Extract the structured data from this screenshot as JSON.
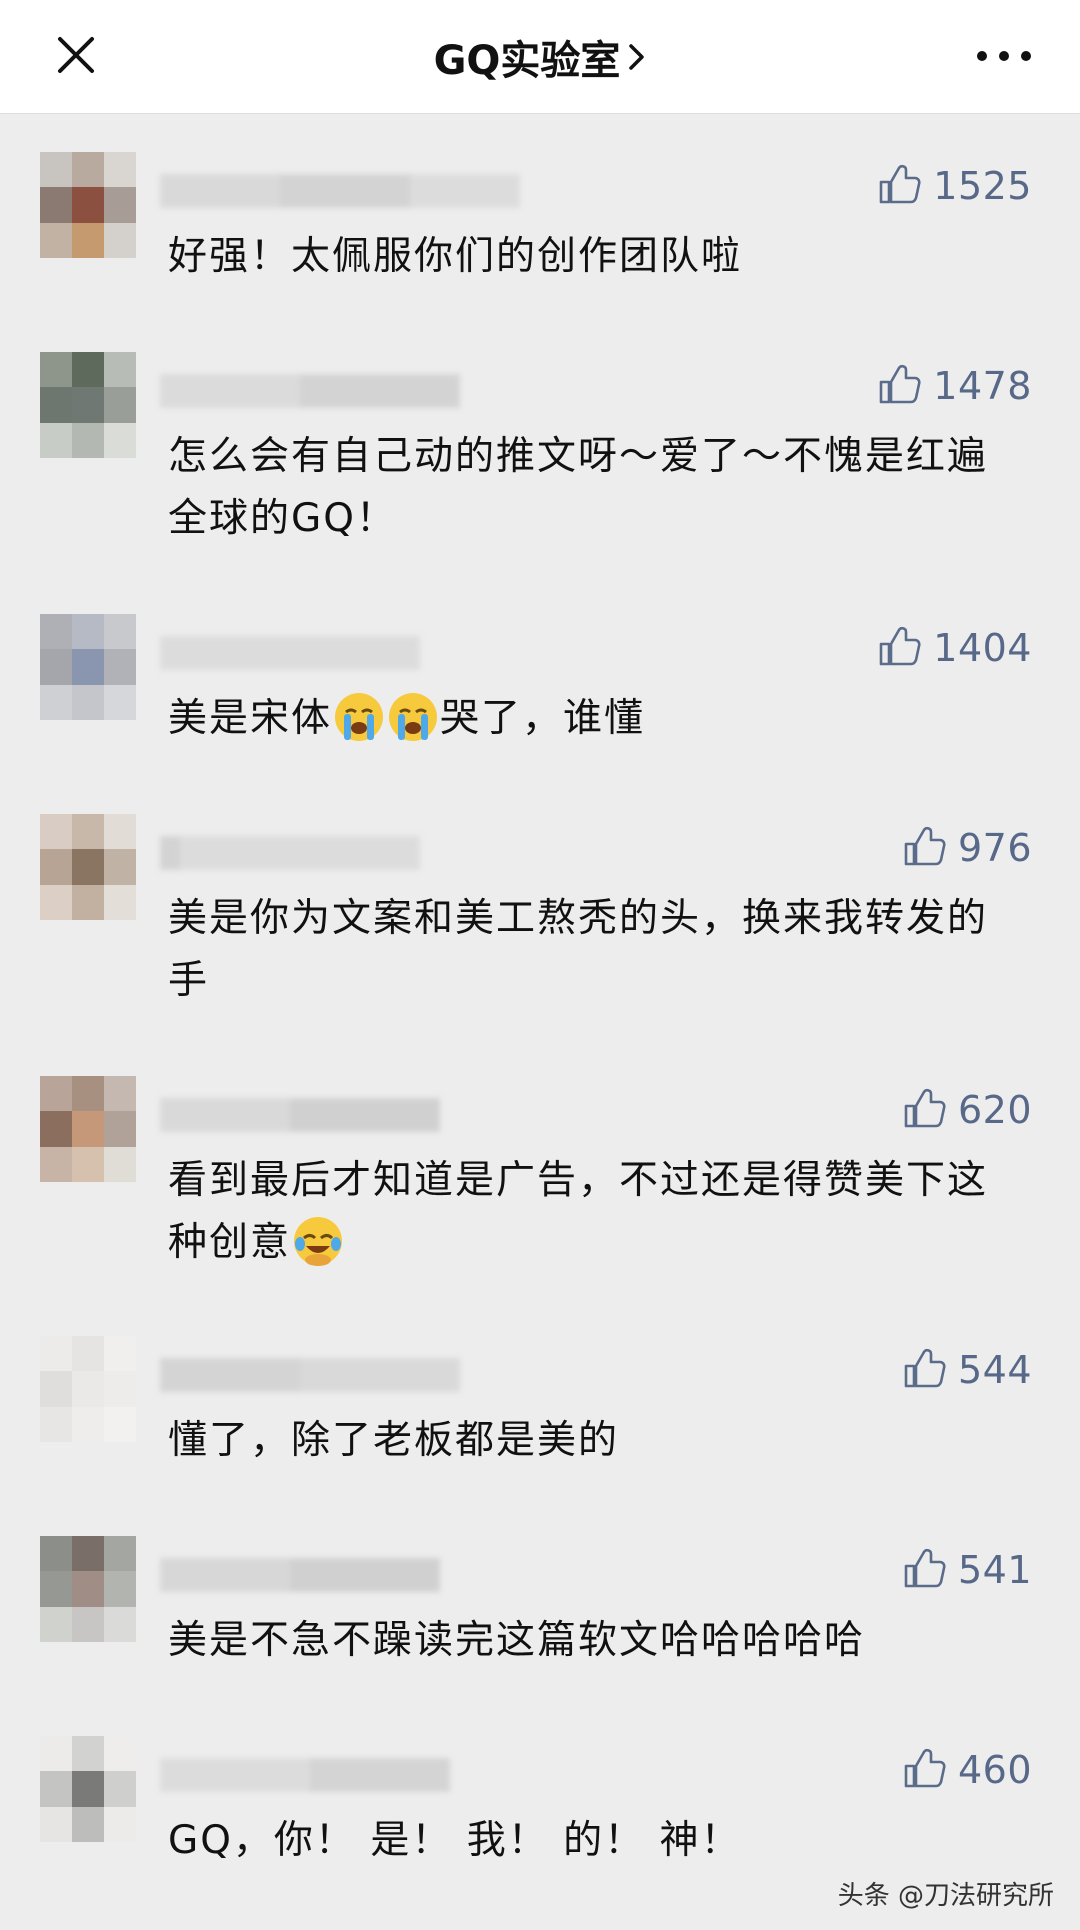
{
  "header": {
    "title": "GQ实验室",
    "close_icon": "close-icon",
    "more_icon": "more-icon"
  },
  "comments": [
    {
      "likes": "1525",
      "text": "好强！太佩服你们的创作团队啦"
    },
    {
      "likes": "1478",
      "text": "怎么会有自己动的推文呀～爱了～不愧是红遍全球的GQ！"
    },
    {
      "likes": "1404",
      "text_a": "美是宋体",
      "text_b": "哭了，谁懂",
      "emoji": "loudly-crying-face"
    },
    {
      "likes": "976",
      "text": "美是你为文案和美工熬秃的头，换来我转发的手"
    },
    {
      "likes": "620",
      "text": "看到最后才知道是广告，不过还是得赞美下这种创意",
      "emoji": "face-with-tears-of-joy"
    },
    {
      "likes": "544",
      "text": "懂了，除了老板都是美的"
    },
    {
      "likes": "541",
      "text": "美是不急不躁读完这篇软文哈哈哈哈哈"
    },
    {
      "likes": "460",
      "text": "GQ，你！ 是！ 我！ 的！ 神！"
    }
  ],
  "watermark": "头条 @刀法研究所",
  "colors": {
    "background": "#ededed",
    "like_icon": "#5b6b8a",
    "text": "#111111"
  }
}
